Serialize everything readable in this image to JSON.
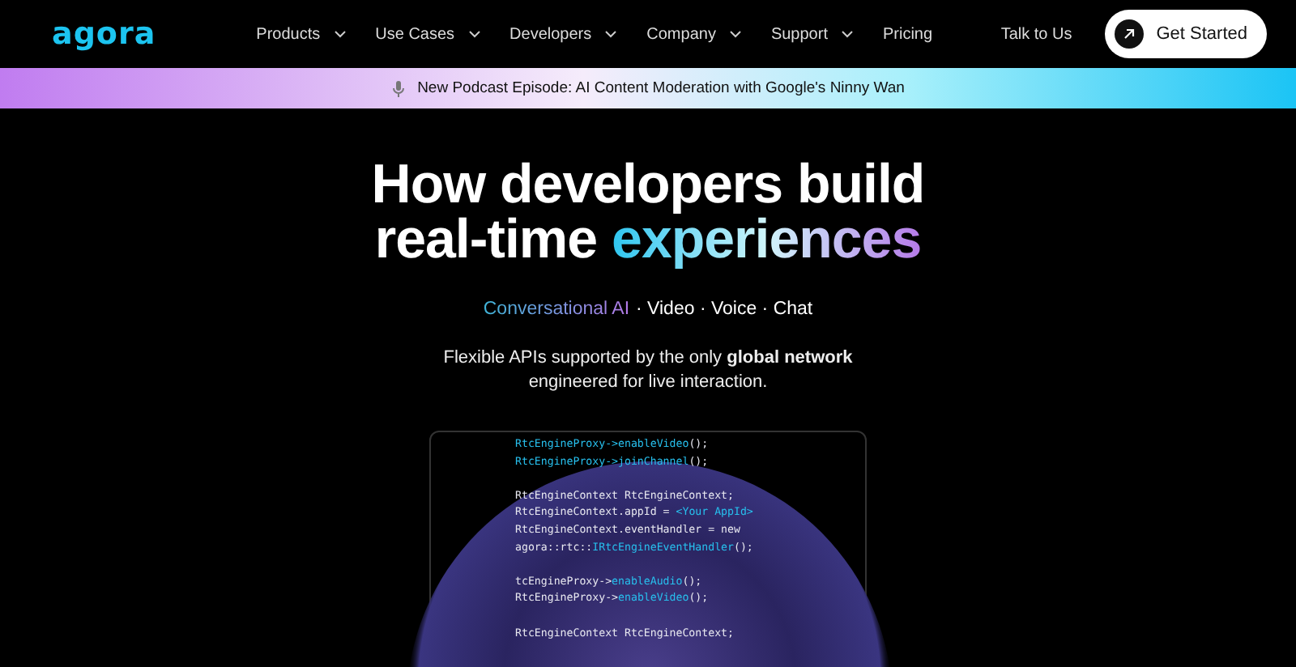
{
  "logo": "agora",
  "nav": [
    {
      "label": "Products",
      "dropdown": true
    },
    {
      "label": "Use Cases",
      "dropdown": true
    },
    {
      "label": "Developers",
      "dropdown": true
    },
    {
      "label": "Company",
      "dropdown": true
    },
    {
      "label": "Support",
      "dropdown": true
    },
    {
      "label": "Pricing",
      "dropdown": false
    }
  ],
  "talk_link": "Talk to Us",
  "cta": "Get Started",
  "banner": "New Podcast Episode: AI Content Moderation with Google's Ninny Wan",
  "headline": {
    "line1": "How developers build",
    "line2": "real-time",
    "highlight": "experiences"
  },
  "tagline": {
    "highlight": "Conversational AI",
    "rest": "· Video · Voice · Chat"
  },
  "description": "Flexible APIs supported by the only **global network** engineered for live interaction.",
  "code": [
    [
      [
        {
          "text": "RtcEngineProxy->enableVideo",
          "kind": "accent"
        },
        {
          "text": "();",
          "kind": "plain"
        }
      ],
      [
        {
          "text": "RtcEngineProxy->joinChannel",
          "kind": "accent"
        },
        {
          "text": "();",
          "kind": "plain"
        }
      ]
    ],
    [
      [
        {
          "text": "RtcEngineContext RtcEngineContext;",
          "kind": "plain"
        }
      ],
      [
        {
          "text": "RtcEngineContext.appId = ",
          "kind": "plain"
        },
        {
          "text": "<Your AppId>",
          "kind": "accent"
        }
      ],
      [
        {
          "text": "RtcEngineContext.eventHandler = new",
          "kind": "plain"
        }
      ],
      [
        {
          "text": "agora::rtc::",
          "kind": "plain"
        },
        {
          "text": "IRtcEngineEventHandler",
          "kind": "accent"
        },
        {
          "text": "();",
          "kind": "plain"
        }
      ]
    ],
    [
      [
        {
          "text": "tcEngineProxy->",
          "kind": "plain"
        },
        {
          "text": "enableAudio",
          "kind": "accent"
        },
        {
          "text": "();",
          "kind": "plain"
        }
      ],
      [
        {
          "text": "RtcEngineProxy->",
          "kind": "plain"
        },
        {
          "text": "enableVideo",
          "kind": "accent"
        },
        {
          "text": "();",
          "kind": "plain"
        }
      ]
    ],
    [
      [
        {
          "text": "RtcEngineContext RtcEngineContext;",
          "kind": "plain"
        }
      ]
    ]
  ]
}
